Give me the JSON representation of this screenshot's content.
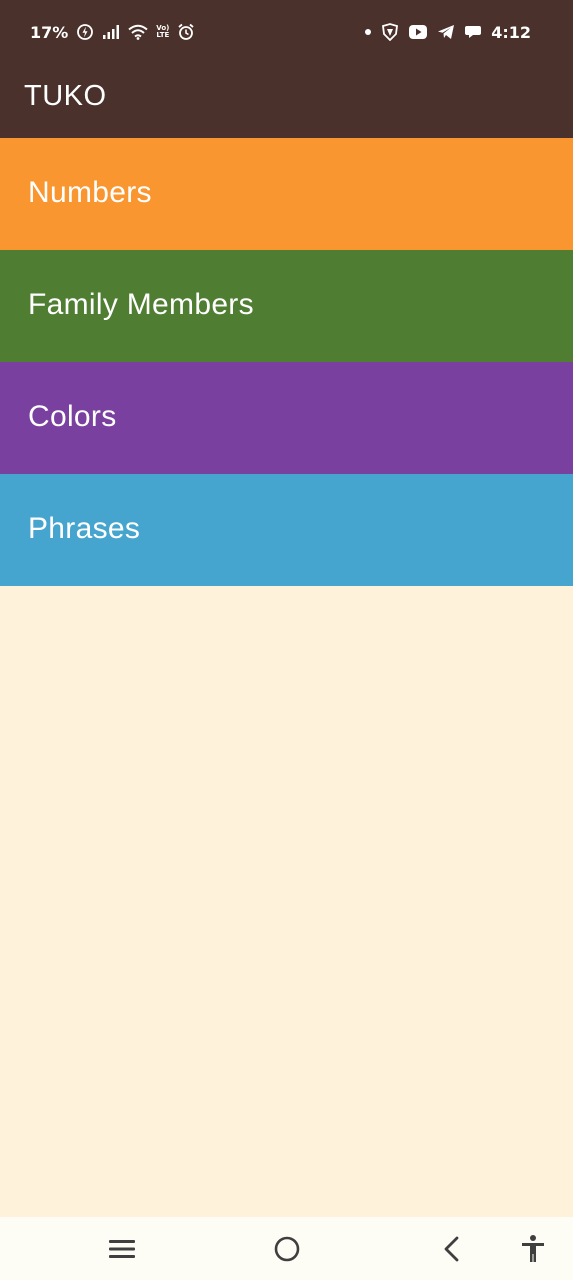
{
  "status_bar": {
    "battery": "17%",
    "volte_top": "Vo)",
    "volte_bottom": "LTE",
    "time": "4:12"
  },
  "app_bar": {
    "title": "TUKO"
  },
  "categories": [
    {
      "label": "Numbers",
      "color": "#F99630"
    },
    {
      "label": "Family Members",
      "color": "#4F7E33"
    },
    {
      "label": "Colors",
      "color": "#7A40A0"
    },
    {
      "label": "Phrases",
      "color": "#46A5CE"
    }
  ],
  "colors": {
    "app_bar": "#4A312B",
    "background": "#FEF3DA"
  },
  "nav_bar": {
    "icons": [
      "menu-icon",
      "home-icon",
      "back-icon",
      "accessibility-icon"
    ]
  }
}
